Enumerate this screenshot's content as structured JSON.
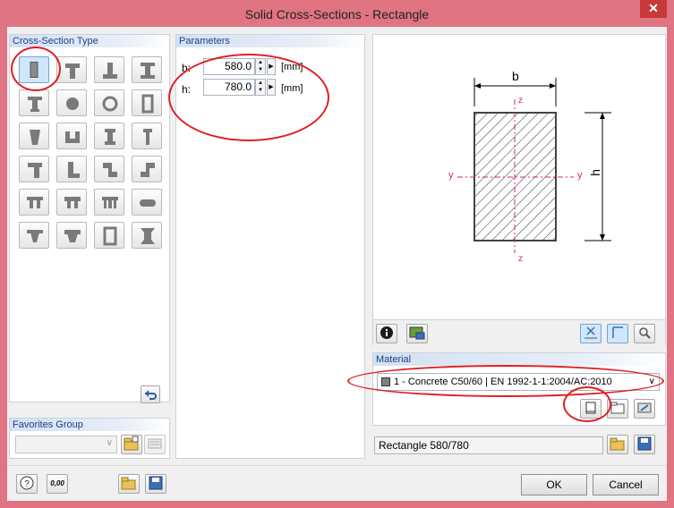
{
  "window": {
    "title": "Solid Cross-Sections - Rectangle",
    "close_glyph": "✕"
  },
  "cross_section": {
    "header": "Cross-Section Type"
  },
  "parameters": {
    "header": "Parameters",
    "b_label": "b:",
    "b_value": "580.0",
    "h_label": "h:",
    "h_value": "780.0",
    "unit": "[mm]"
  },
  "preview": {
    "b": "b",
    "h": "h",
    "y": "y",
    "z": "z"
  },
  "favorites": {
    "header": "Favorites Group",
    "value": ""
  },
  "material": {
    "header": "Material",
    "value": "1 - Concrete C50/60 | EN 1992-1-1:2004/AC:2010",
    "swatch_color": "#7f7f7f"
  },
  "name_field": {
    "value": "Rectangle 580/780"
  },
  "buttons": {
    "ok": "OK",
    "cancel": "Cancel"
  },
  "icons": {
    "info": "info-icon",
    "restore": "undo-arrow-icon",
    "calc": "0,00"
  },
  "colors": {
    "title_bg": "#e07482",
    "highlight": "#e01e24",
    "accent": "#d11f7a"
  }
}
